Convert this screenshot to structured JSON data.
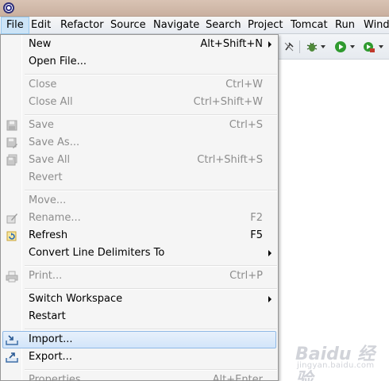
{
  "menubar": {
    "items": [
      {
        "label": "File"
      },
      {
        "label": "Edit"
      },
      {
        "label": "Refactor"
      },
      {
        "label": "Source"
      },
      {
        "label": "Navigate"
      },
      {
        "label": "Search"
      },
      {
        "label": "Project"
      },
      {
        "label": "Tomcat"
      },
      {
        "label": "Run"
      },
      {
        "label": "Wind"
      }
    ]
  },
  "toolbar": {
    "icons": [
      "pin-icon",
      "debug-bug-icon",
      "run-icon",
      "external-tools-icon"
    ]
  },
  "file_menu": {
    "groups": [
      [
        {
          "label": "New",
          "shortcut": "Alt+Shift+N",
          "submenu": true,
          "enabled": true
        },
        {
          "label": "Open File...",
          "shortcut": "",
          "enabled": true
        }
      ],
      [
        {
          "label": "Close",
          "shortcut": "Ctrl+W",
          "enabled": false
        },
        {
          "label": "Close All",
          "shortcut": "Ctrl+Shift+W",
          "enabled": false
        }
      ],
      [
        {
          "label": "Save",
          "shortcut": "Ctrl+S",
          "enabled": false,
          "icon": "save-icon"
        },
        {
          "label": "Save As...",
          "shortcut": "",
          "enabled": false,
          "icon": "save-as-icon"
        },
        {
          "label": "Save All",
          "shortcut": "Ctrl+Shift+S",
          "enabled": false,
          "icon": "save-all-icon"
        },
        {
          "label": "Revert",
          "shortcut": "",
          "enabled": false
        }
      ],
      [
        {
          "label": "Move...",
          "shortcut": "",
          "enabled": false
        },
        {
          "label": "Rename...",
          "shortcut": "F2",
          "enabled": false,
          "icon": "rename-icon"
        },
        {
          "label": "Refresh",
          "shortcut": "F5",
          "enabled": true,
          "icon": "refresh-icon"
        },
        {
          "label": "Convert Line Delimiters To",
          "shortcut": "",
          "submenu": true,
          "enabled": true
        }
      ],
      [
        {
          "label": "Print...",
          "shortcut": "Ctrl+P",
          "enabled": false,
          "icon": "print-icon"
        }
      ],
      [
        {
          "label": "Switch Workspace",
          "shortcut": "",
          "submenu": true,
          "enabled": true
        },
        {
          "label": "Restart",
          "shortcut": "",
          "enabled": true
        }
      ],
      [
        {
          "label": "Import...",
          "shortcut": "",
          "enabled": true,
          "highlighted": true,
          "icon": "import-icon"
        },
        {
          "label": "Export...",
          "shortcut": "",
          "enabled": true,
          "icon": "export-icon"
        }
      ],
      [
        {
          "label": "Properties",
          "shortcut": "Alt+Enter",
          "enabled": false
        }
      ]
    ]
  },
  "watermark": {
    "brand": "Baidu 经验",
    "url": "jingyan.baidu.com"
  },
  "colors": {
    "highlight": "#d3e5fa",
    "highlight_border": "#8fb9e6",
    "menu_bg": "#f5f5f5",
    "disabled_text": "#8d8d8d",
    "active_menu": "#cce4f7"
  }
}
